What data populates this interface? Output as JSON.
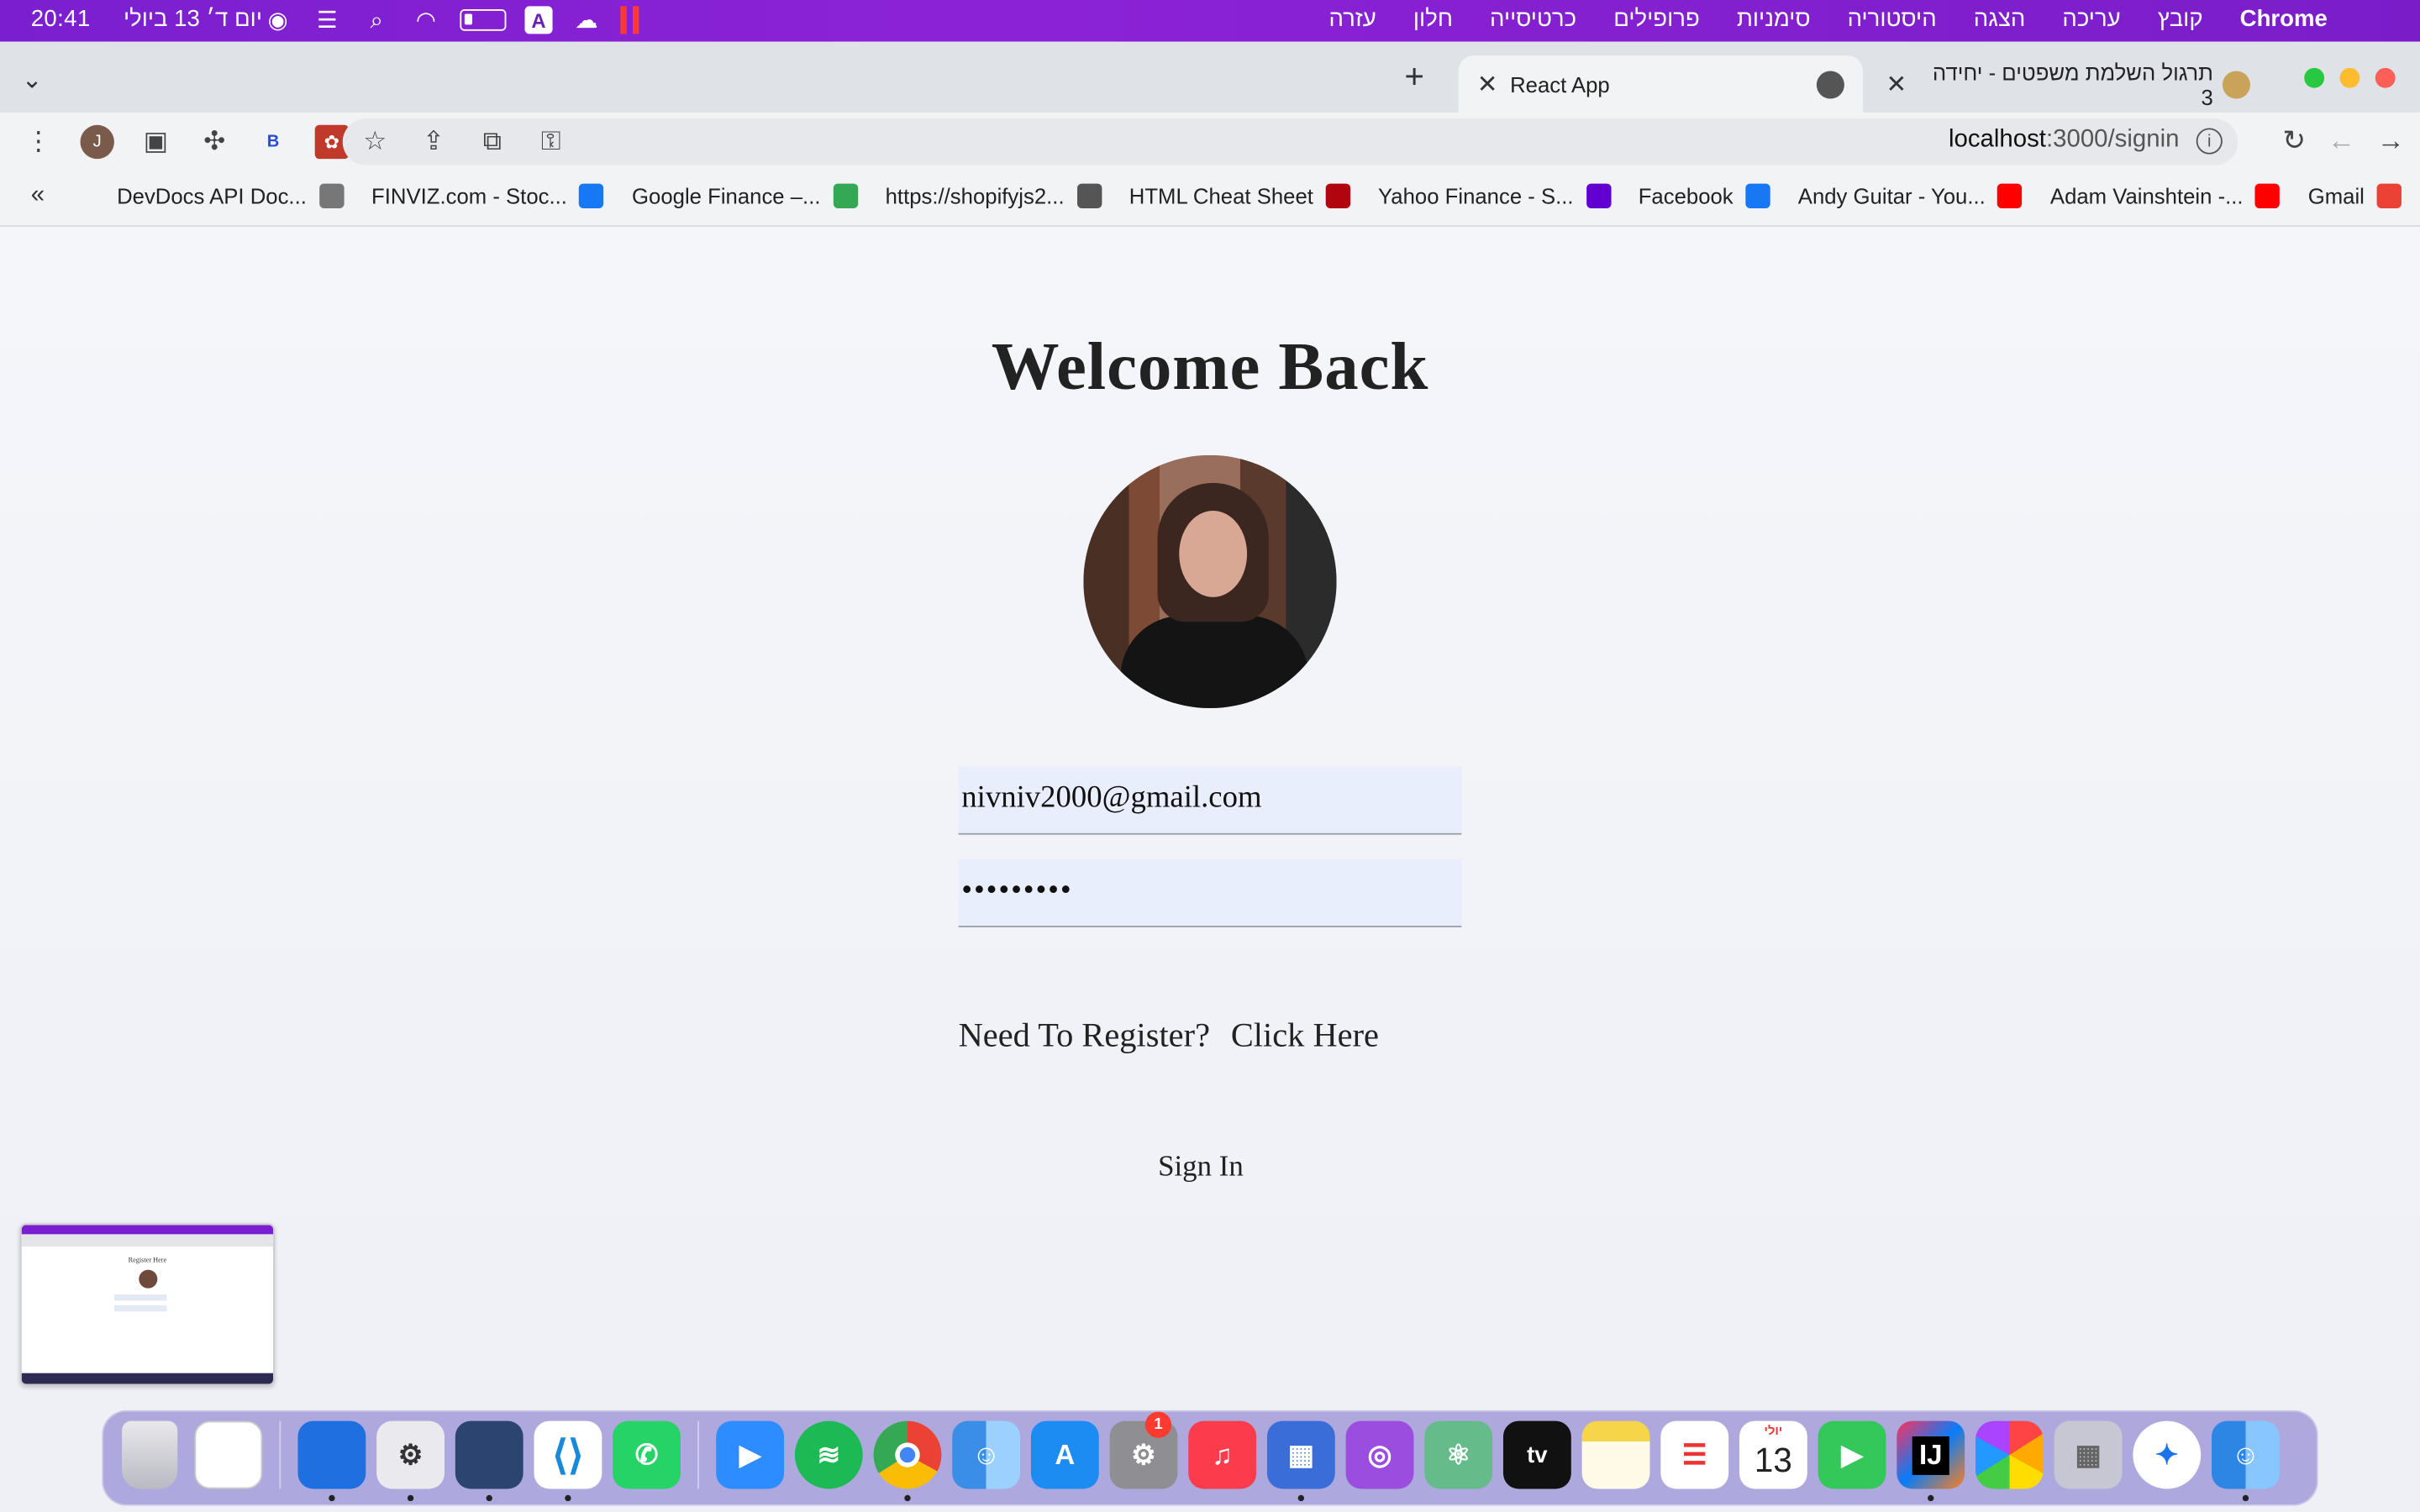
{
  "menubar": {
    "clock": "20:41",
    "date": "יום ד׳ 13 ביולי",
    "app_name": "Chrome",
    "menus": [
      "Chrome",
      "קובץ",
      "עריכה",
      "הצגה",
      "היסטוריה",
      "סימניות",
      "פרופילים",
      "כרטיסייה",
      "חלון",
      "עזרה"
    ],
    "input_badge": "A"
  },
  "tabs": {
    "active": {
      "title": "React App"
    },
    "inactive": {
      "title": "תרגול השלמת משפטים - יחידה 3"
    }
  },
  "toolbar": {
    "url_host": "localhost",
    "url_path": ":3000/signin",
    "profile_initial": "J",
    "ext_b": "B"
  },
  "bookmarks": [
    {
      "label": "Gmail",
      "icon": "gmail-icon",
      "color": "#ea4335"
    },
    {
      "label": "Adam Vainshtein -...",
      "icon": "youtube-icon",
      "color": "#ff0000"
    },
    {
      "label": "Andy Guitar - You...",
      "icon": "youtube-icon",
      "color": "#ff0000"
    },
    {
      "label": "Facebook",
      "icon": "facebook-icon",
      "color": "#1877f2"
    },
    {
      "label": "Yahoo Finance - S...",
      "icon": "yahoo-icon",
      "color": "#6001d2"
    },
    {
      "label": "HTML Cheat Sheet",
      "icon": "stanford-icon",
      "color": "#b1040e"
    },
    {
      "label": "https://shopifyjs2...",
      "icon": "globe-icon",
      "color": "#555555"
    },
    {
      "label": "Google Finance –...",
      "icon": "google-finance-icon",
      "color": "#34a853"
    },
    {
      "label": "FINVIZ.com - Stoc...",
      "icon": "facebook-icon",
      "color": "#1877f2"
    },
    {
      "label": "DevDocs API Doc...",
      "icon": "search-icon",
      "color": "#777777"
    }
  ],
  "page": {
    "title": "Welcome Back",
    "email_value": "nivniv2000@gmail.com",
    "password_value": "•••••••••",
    "register_prompt": "Need To Register?",
    "register_link": "Click Here",
    "signin_button": "Sign In"
  },
  "thumbnail": {
    "title": "Register Here"
  },
  "dock": {
    "calendar_month": "יולי",
    "calendar_day": "13",
    "settings_badge": "1",
    "tv_label": "tv",
    "intellij_label": "IJ"
  }
}
